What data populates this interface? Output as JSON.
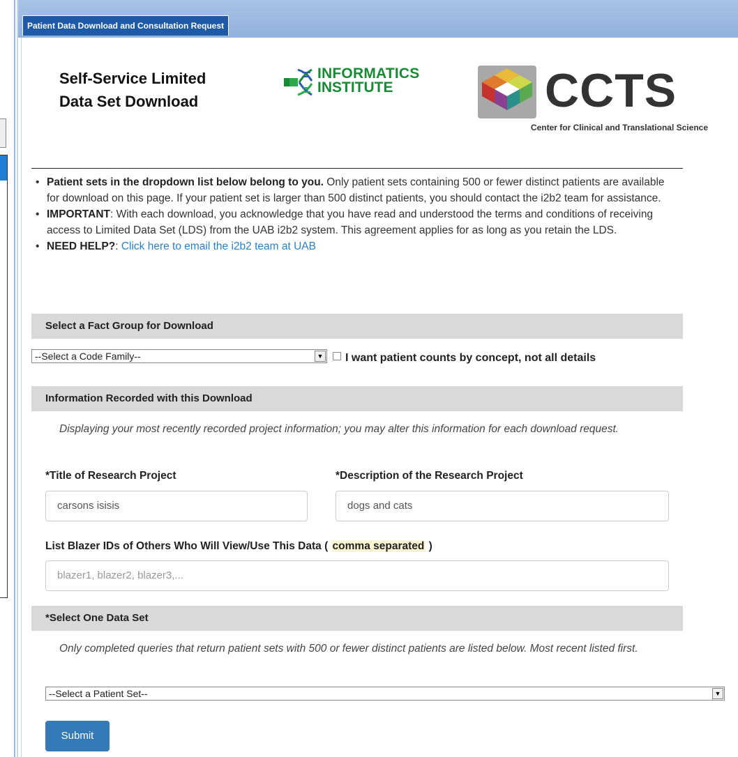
{
  "tab": {
    "label": "Patient Data Download and Consultation Request"
  },
  "header": {
    "title_line1": "Self-Service Limited",
    "title_line2": "Data Set Download",
    "informatics_line1": "INFORMATICS",
    "informatics_line2": "INSTITUTE",
    "ccts_name": "CCTS",
    "ccts_sub": "Center for Clinical and Translational Science"
  },
  "bullets": {
    "b1_bold": "Patient sets in the dropdown list below belong to you.",
    "b1_text": " Only patient sets containing 500 or fewer distinct patients are available for download on this page. If your patient set is larger than 500 distinct patients, you should contact the i2b2 team for assistance.",
    "b2_bold": "IMPORTANT",
    "b2_text": ": With each download, you acknowledge that you have read and understood the terms and conditions of receiving access to Limited Data Set (LDS) from the UAB i2b2 system. This agreement applies for as long as you retain the LDS.",
    "b3_bold": "NEED HELP?",
    "b3_colon": ": ",
    "b3_link": "Click here to email the i2b2 team at UAB"
  },
  "fact_group": {
    "section_title": "Select a Fact Group for Download",
    "select_value": "--Select a Code Family--",
    "checkbox_label": "I want patient counts by concept, not all details",
    "checkbox_checked": false
  },
  "info": {
    "section_title": "Information Recorded with this Download",
    "note": "Displaying your most recently recorded project information; you may alter this information for each download request.",
    "title_label": "*Title of Research Project",
    "title_value": "carsons isisis",
    "desc_label": "*Description of the Research Project",
    "desc_value": "dogs and cats",
    "blazer_label_pre": "List Blazer IDs of Others Who Will View/Use This Data ( ",
    "blazer_label_hl": "comma separated",
    "blazer_label_post": " )",
    "blazer_placeholder": "blazer1, blazer2, blazer3,..."
  },
  "dataset": {
    "section_title": "*Select One Data Set",
    "note": "Only completed queries that return patient sets with 500 or fewer distinct patients are listed below. Most recent listed first.",
    "select_value": "--Select a Patient Set--"
  },
  "submit_label": "Submit"
}
